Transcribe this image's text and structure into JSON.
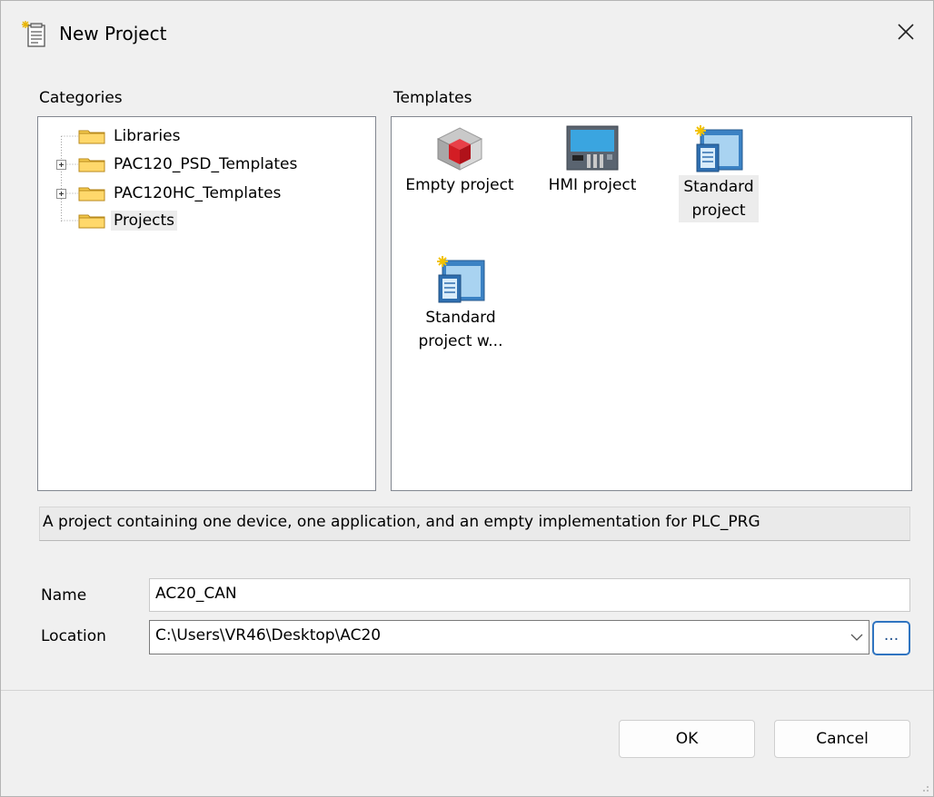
{
  "window": {
    "title": "New Project",
    "close_glyph": "✕"
  },
  "categories": {
    "label": "Categories",
    "items": [
      {
        "label": "Libraries",
        "expandable": false,
        "selected": false
      },
      {
        "label": "PAC120_PSD_Templates",
        "expandable": true,
        "selected": false
      },
      {
        "label": "PAC120HC_Templates",
        "expandable": true,
        "selected": false
      },
      {
        "label": "Projects",
        "expandable": false,
        "selected": true
      }
    ]
  },
  "templates": {
    "label": "Templates",
    "items": [
      {
        "label": "Empty project",
        "icon": "cube-icon",
        "selected": false
      },
      {
        "label": "HMI project",
        "icon": "hmi-panel-icon",
        "selected": false
      },
      {
        "label": "Standard project",
        "icon": "standard-project-icon",
        "selected": true
      },
      {
        "label": "Standard project w...",
        "icon": "standard-project-icon",
        "selected": false
      }
    ]
  },
  "description": "A project containing one device, one application, and an empty implementation for PLC_PRG",
  "form": {
    "name_label": "Name",
    "name_value": "AC20_CAN",
    "location_label": "Location",
    "location_value": "C:\\Users\\VR46\\Desktop\\AC20",
    "browse_label": "..."
  },
  "buttons": {
    "ok": "OK",
    "cancel": "Cancel"
  },
  "colors": {
    "folder": "#f5c94c",
    "accent": "#2f74c0",
    "selection": "#ececec"
  }
}
